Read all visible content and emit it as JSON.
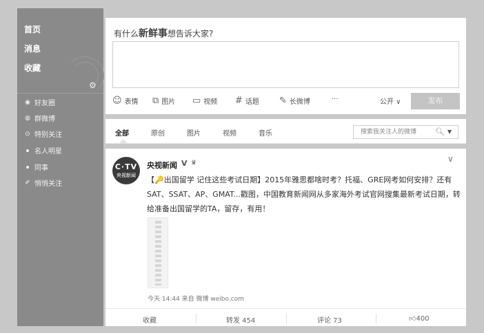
{
  "sidebar": {
    "top_items": [
      {
        "label": "首页"
      },
      {
        "label": "消息"
      },
      {
        "label": "收藏"
      }
    ],
    "groups": [
      {
        "label": "好友圈",
        "icon": "circle-icon"
      },
      {
        "label": "群微博",
        "icon": "group-icon"
      },
      {
        "label": "特别关注",
        "icon": "star-circle-icon"
      },
      {
        "label": "名人明星",
        "icon": "dot-icon"
      },
      {
        "label": "同事",
        "icon": "dot-icon"
      },
      {
        "label": "悄悄关注",
        "icon": "pin-icon"
      }
    ]
  },
  "composer": {
    "prompt_lead": "有什么",
    "prompt_bold": "新鲜事",
    "prompt_tail": "想告诉大家?",
    "tools": [
      {
        "label": "表情",
        "glyph": "☺"
      },
      {
        "label": "图片",
        "glyph": "⧉"
      },
      {
        "label": "视频",
        "glyph": "▭"
      },
      {
        "label": "话题",
        "glyph": "#"
      },
      {
        "label": "长微博",
        "glyph": "✎"
      },
      {
        "label": "···",
        "glyph": ""
      }
    ],
    "visibility": "公开 ∨",
    "post_label": "发布"
  },
  "tabs": {
    "items": [
      "全部",
      "原创",
      "图片",
      "视频",
      "音乐"
    ],
    "search_placeholder": "搜索我关注人的微博"
  },
  "feed": {
    "avatar_top": "C·TV",
    "avatar_bottom": "央视新闻",
    "author": "央视新闻",
    "verified": "V",
    "post_text": "【🔑出国留学 记住这些考试日期】2015年雅思都啥时考？托福、GRE网考如何安排？还有SAT、SSAT、AP、GMAT...戳图，中国教育新闻网从多家海外考试官网搜集最新考试日期，转给准备出国留学的TA，留存，有用！",
    "meta": "今天 14:44 来自 微博 weibo.com",
    "actions": {
      "favorite": "收藏",
      "repost": "转发 454",
      "comment": "评论 73",
      "like": "400"
    }
  }
}
